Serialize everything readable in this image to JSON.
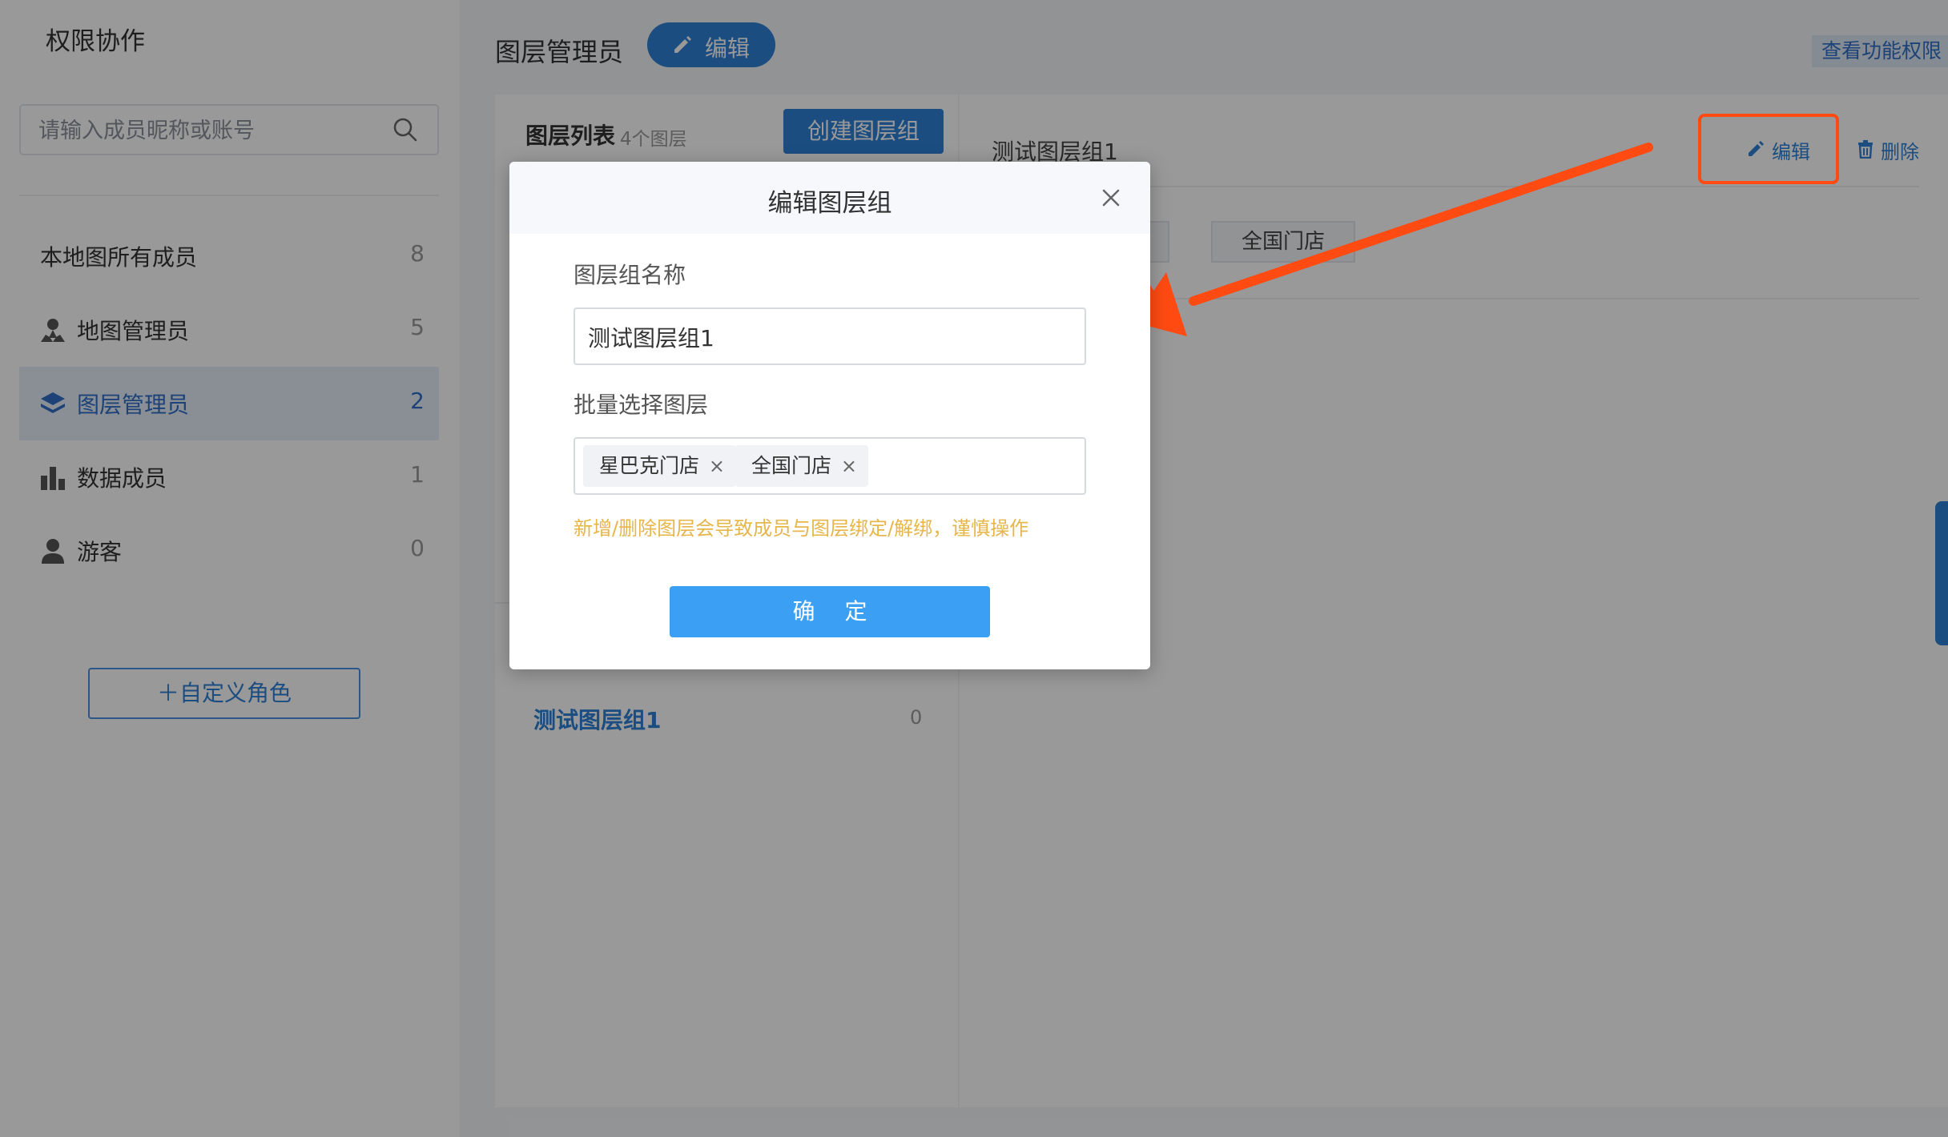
{
  "sidebar": {
    "title": "权限协作",
    "search_placeholder": "请输入成员昵称或账号",
    "items": [
      {
        "label": "本地图所有成员",
        "count": "8"
      },
      {
        "label": "地图管理员",
        "count": "5"
      },
      {
        "label": "图层管理员",
        "count": "2"
      },
      {
        "label": "数据成员",
        "count": "1"
      },
      {
        "label": "游客",
        "count": "0"
      }
    ],
    "add_role": "＋自定义角色"
  },
  "header": {
    "title": "图层管理员",
    "edit": "编辑",
    "view_permissions": "查看功能权限"
  },
  "layer_panel": {
    "heading": "图层列表",
    "count": "4个图层",
    "create": "创建图层组",
    "group_name": "测试图层组1",
    "group_count": "0"
  },
  "detail": {
    "name": "测试图层组1",
    "edit": "编辑",
    "delete": "删除",
    "tag": "全国门店"
  },
  "modal": {
    "title": "编辑图层组",
    "name_label": "图层组名称",
    "name_value": "测试图层组1",
    "layers_label": "批量选择图层",
    "tags": [
      "星巴克门店",
      "全国门店"
    ],
    "warning": "新增/删除图层会导致成员与图层绑定/解绑，谨慎操作",
    "confirm": "确 定"
  },
  "colors": {
    "primary": "#2f80d8",
    "confirm_button": "#3ba0f3",
    "warning_text": "#e6b64a",
    "annotation": "#ff4a12"
  }
}
